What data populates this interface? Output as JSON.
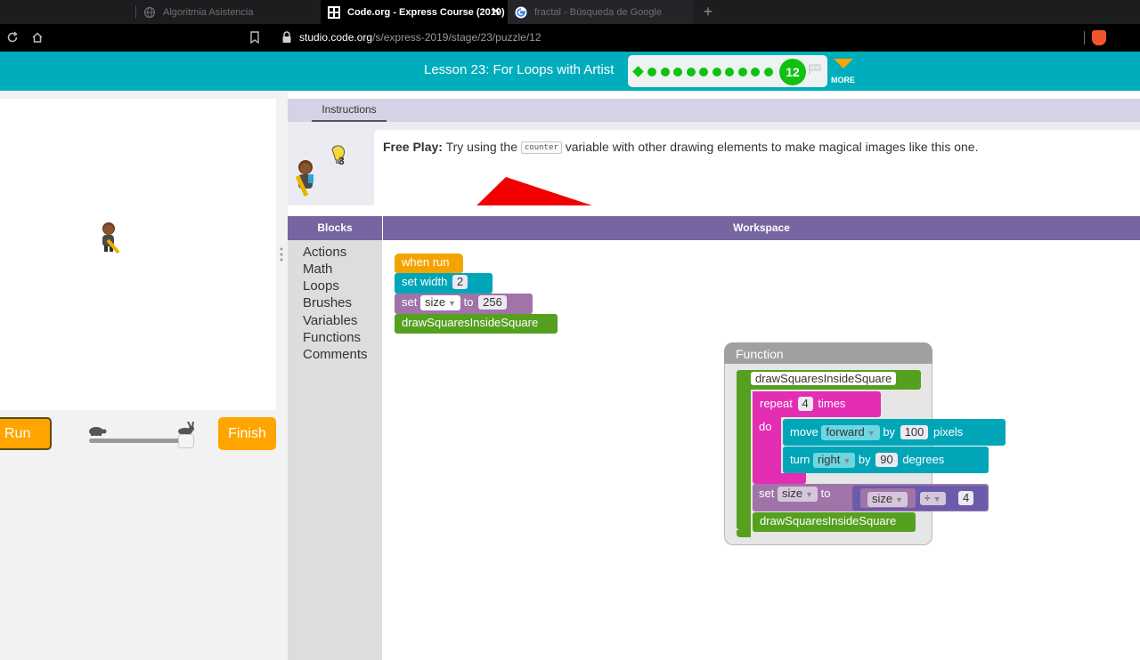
{
  "browser": {
    "tabs": [
      {
        "title": "Algoritmia Asistencia",
        "icon": "globe-icon"
      },
      {
        "title": "Code.org - Express Course (2019)",
        "icon": "codeorg-icon"
      },
      {
        "title": "fractal - Búsqueda de Google",
        "icon": "google-icon"
      }
    ],
    "close_symbol": "✕",
    "newtab_symbol": "+",
    "url_domain": "studio.code.org",
    "url_path": "/s/express-2019/stage/23/puzzle/12"
  },
  "header": {
    "lesson_title": "Lesson 23: For Loops with Artist",
    "current_level": "12",
    "more_label": "MORE"
  },
  "left": {
    "run_label": "Run",
    "finish_label": "Finish",
    "speed_level": 1.0
  },
  "instructions": {
    "tab_label": "Instructions",
    "hint_count": "3",
    "lead": "Free Play:",
    "before": "Try using the",
    "code": "counter",
    "after": "variable with other drawing elements to make magical images like this one."
  },
  "toolbox": {
    "header": "Blocks",
    "categories": [
      "Actions",
      "Math",
      "Loops",
      "Brushes",
      "Variables",
      "Functions",
      "Comments"
    ]
  },
  "workspace": {
    "header": "Workspace",
    "main_blocks": {
      "when_run": "when run",
      "set_width": "set width",
      "width_value": "2",
      "set": "set",
      "var_name": "size",
      "to": "to",
      "size_value": "256",
      "call": "drawSquaresInsideSquare"
    },
    "function": {
      "title": "Function",
      "name": "drawSquaresInsideSquare",
      "repeat": "repeat",
      "repeat_count": "4",
      "times": "times",
      "do": "do",
      "move": "move",
      "direction": "forward",
      "by": "by",
      "distance": "100",
      "pixels": "pixels",
      "turn": "turn",
      "turn_dir": "right",
      "angle": "90",
      "degrees": "degrees",
      "set": "set",
      "var_name": "size",
      "to": "to",
      "operator": "÷",
      "divisor": "4",
      "call": "drawSquaresInsideSquare"
    }
  },
  "colors": {
    "header": "#00adbc",
    "progress_green": "#0fc20f",
    "button_orange": "#ffa400",
    "blockly_purple": "#7665a0",
    "event_block": "#f4a400",
    "turtle_block": "#00a6b8",
    "variable_block": "#a074a8",
    "math_block": "#6b5cab",
    "procedure_block": "#55a01f",
    "loop_block": "#e32db3"
  }
}
